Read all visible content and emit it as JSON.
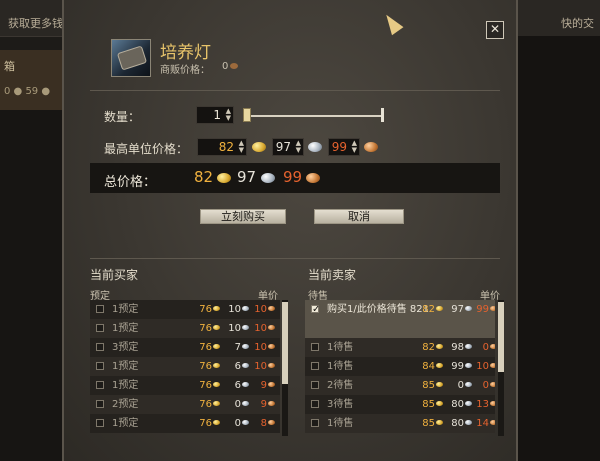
{
  "background": {
    "left_tab": "获取更多钱",
    "right_tab": "快的交",
    "left_panel_title": "箱",
    "left_panel_sub": "0 ● 59 ●"
  },
  "dialog": {
    "close_glyph": "✕",
    "item_name": "培养灯",
    "vendor_label": "商贩价格：",
    "vendor_value": "0",
    "quantity_label": "数量：",
    "quantity_value": "1",
    "max_price_label": "最高单位价格：",
    "max_price": {
      "gold": "82",
      "silver": "97",
      "copper": "99"
    },
    "total_label": "总价格：",
    "total": {
      "gold": "82",
      "silver": "97",
      "copper": "99"
    },
    "buy_now_button": "立刻购买",
    "cancel_button": "取消"
  },
  "buyers": {
    "title": "当前买家",
    "col_left": "预定",
    "col_right": "单价",
    "rows": [
      {
        "label": "1预定",
        "gold": "76",
        "silver": "10",
        "copper": "10"
      },
      {
        "label": "1预定",
        "gold": "76",
        "silver": "10",
        "copper": "10"
      },
      {
        "label": "3预定",
        "gold": "76",
        "silver": "7",
        "copper": "10"
      },
      {
        "label": "1预定",
        "gold": "76",
        "silver": "6",
        "copper": "10"
      },
      {
        "label": "1预定",
        "gold": "76",
        "silver": "6",
        "copper": "9"
      },
      {
        "label": "2预定",
        "gold": "76",
        "silver": "0",
        "copper": "9"
      },
      {
        "label": "1预定",
        "gold": "76",
        "silver": "0",
        "copper": "8"
      }
    ]
  },
  "sellers": {
    "title": "当前卖家",
    "col_left": "待售",
    "col_right": "单价",
    "rows": [
      {
        "label": "购买1/此价格待售 821",
        "gold": "82",
        "silver": "97",
        "copper": "99",
        "selected": true
      },
      {
        "label": "1待售",
        "gold": "82",
        "silver": "98",
        "copper": "0"
      },
      {
        "label": "1待售",
        "gold": "84",
        "silver": "99",
        "copper": "10"
      },
      {
        "label": "2待售",
        "gold": "85",
        "silver": "0",
        "copper": "0"
      },
      {
        "label": "3待售",
        "gold": "85",
        "silver": "80",
        "copper": "13"
      },
      {
        "label": "1待售",
        "gold": "85",
        "silver": "80",
        "copper": "14"
      }
    ]
  },
  "colors": {
    "gold_text": "#f0b13e",
    "silver_text": "#e6e2d8",
    "copper_text": "#e5622e",
    "item_name": "#e8c46a"
  }
}
